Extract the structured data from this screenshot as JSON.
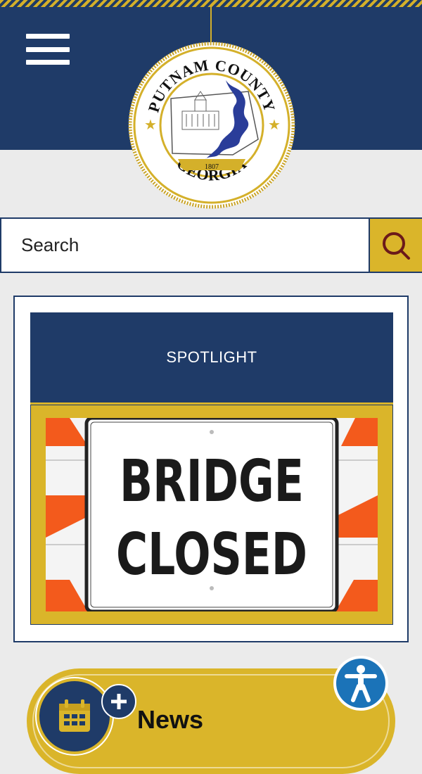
{
  "header": {
    "menu_icon": "hamburger-menu-icon",
    "seal": {
      "top_text": "PUTNAM COUNTY",
      "bottom_text": "GEORGIA",
      "year": "1807"
    }
  },
  "search": {
    "placeholder": "Search",
    "button_icon": "search-icon"
  },
  "spotlight": {
    "heading": "SPOTLIGHT",
    "sign_line1": "BRIDGE",
    "sign_line2": "CLOSED"
  },
  "news": {
    "label": "News",
    "icon": "calendar-icon",
    "badge_icon": "plus-icon"
  },
  "accessibility": {
    "icon": "accessibility-icon"
  },
  "colors": {
    "navy": "#1f3b68",
    "gold": "#dab52a",
    "accessibility_blue": "#1b73b8",
    "background": "#ebebeb"
  }
}
